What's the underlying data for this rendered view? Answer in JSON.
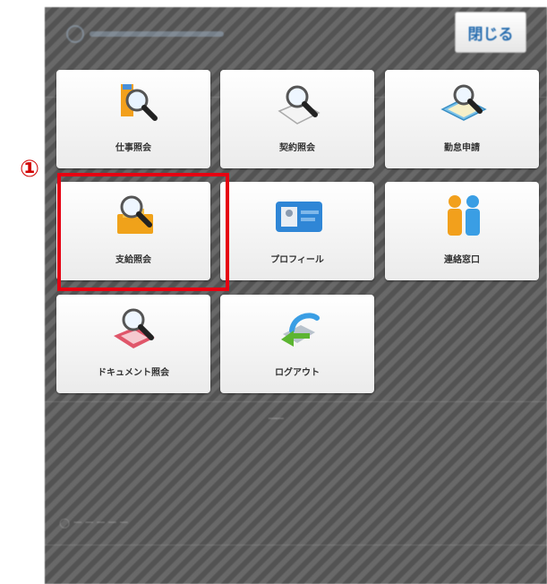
{
  "annotation": {
    "marker": "①",
    "color": "#e60012"
  },
  "header": {
    "logo_icon": "company-logo-icon",
    "close_label": "閉じる"
  },
  "menu": {
    "tiles": [
      {
        "label": "仕事照会",
        "icon": "job-inquiry-icon"
      },
      {
        "label": "契約照会",
        "icon": "contract-inquiry-icon"
      },
      {
        "label": "勤怠申請",
        "icon": "attendance-request-icon"
      },
      {
        "label": "支給照会",
        "icon": "payment-inquiry-icon"
      },
      {
        "label": "プロフィール",
        "icon": "profile-card-icon"
      },
      {
        "label": "連絡窓口",
        "icon": "contact-people-icon"
      },
      {
        "label": "ドキュメント照会",
        "icon": "document-inquiry-icon"
      },
      {
        "label": "ログアウト",
        "icon": "logout-icon"
      }
    ]
  },
  "background": {
    "stripe_colors": [
      "#5c5c5c",
      "#6a6a6a"
    ]
  }
}
